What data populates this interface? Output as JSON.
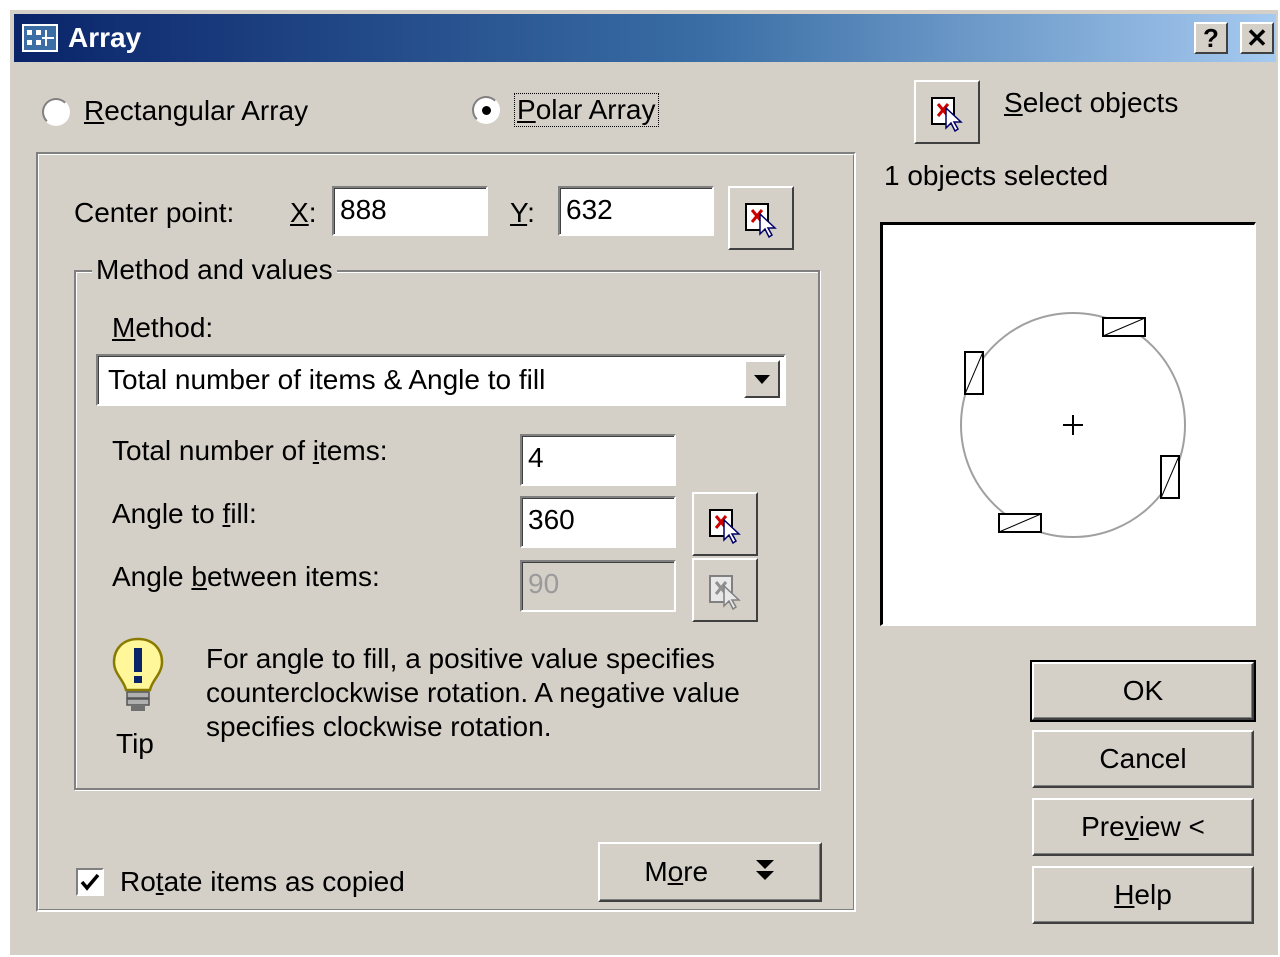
{
  "window": {
    "title": "Array",
    "help_button": "?",
    "close_button": "✕"
  },
  "array_type": {
    "rectangular": {
      "label": "Rectangular Array",
      "underline": "R",
      "rest": "ectangular Array",
      "selected": false
    },
    "polar": {
      "label": "Polar Array",
      "underline": "P",
      "rest": "olar Array",
      "selected": true
    }
  },
  "select_objects": {
    "label_u": "S",
    "label_rest": "elect objects",
    "status": "1 objects selected"
  },
  "center_point": {
    "label": "Center point:",
    "x_label_u": "X",
    "x_label_rest": ":",
    "x_value": "888",
    "y_label_u": "Y",
    "y_label_rest": ":",
    "y_value": "632"
  },
  "method_group": {
    "legend": "Method and values",
    "method_label_u": "M",
    "method_label_rest": "ethod:",
    "method_value": "Total number of items & Angle to fill",
    "total_label_pre": "Total number of ",
    "total_label_u": "i",
    "total_label_post": "tems:",
    "total_value": "4",
    "angle_fill_pre": "Angle to ",
    "angle_fill_u": "f",
    "angle_fill_post": "ill:",
    "angle_fill_value": "360",
    "angle_between_pre": "Angle ",
    "angle_between_u": "b",
    "angle_between_post": "etween items:",
    "angle_between_value": "90",
    "tip_label": "Tip",
    "tip_line1": "For angle to fill, a positive value specifies",
    "tip_line2": "counterclockwise rotation.  A negative value",
    "tip_line3": "specifies clockwise rotation."
  },
  "rotate": {
    "pre": "Ro",
    "u": "t",
    "post": "ate items as copied",
    "checked": true
  },
  "more_button": {
    "pre": "M",
    "u": "o",
    "post": "re",
    "arrow": "⯯"
  },
  "buttons": {
    "ok": "OK",
    "cancel": "Cancel",
    "preview_pre": "Pre",
    "preview_u": "v",
    "preview_post": "iew <",
    "help_u": "H",
    "help_post": "elp"
  }
}
